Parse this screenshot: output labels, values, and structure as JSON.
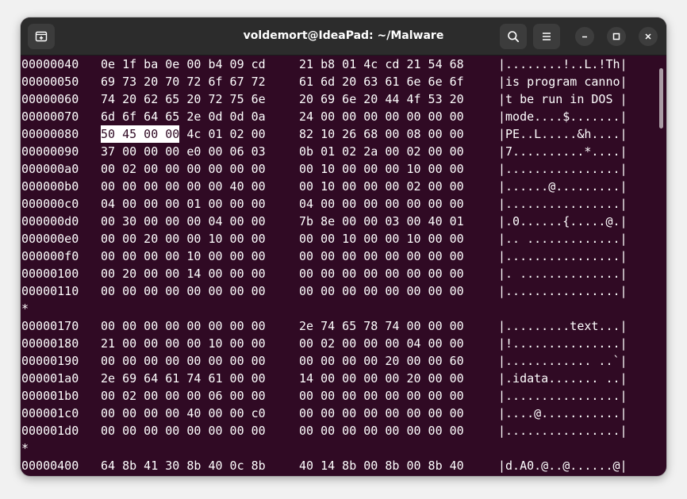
{
  "window": {
    "title": "voldemort@IdeaPad: ~/Malware"
  },
  "icons": {
    "new_tab": "new-tab-icon",
    "search": "search-icon",
    "menu": "hamburger-menu-icon",
    "minimize": "minimize-icon",
    "maximize": "maximize-icon",
    "close": "close-icon"
  },
  "colors": {
    "terminal_bg": "#300a24",
    "titlebar_bg": "#2c2c2c",
    "text": "#ffffff"
  },
  "hexdump": [
    {
      "addr": "00000040",
      "b1": "0e 1f ba 0e 00 b4 09 cd",
      "b2": "21 b8 01 4c cd 21 54 68",
      "ascii": "|........!..L.!Th|"
    },
    {
      "addr": "00000050",
      "b1": "69 73 20 70 72 6f 67 72",
      "b2": "61 6d 20 63 61 6e 6e 6f",
      "ascii": "|is program canno|"
    },
    {
      "addr": "00000060",
      "b1": "74 20 62 65 20 72 75 6e",
      "b2": "20 69 6e 20 44 4f 53 20",
      "ascii": "|t be run in DOS |"
    },
    {
      "addr": "00000070",
      "b1": "6d 6f 64 65 2e 0d 0d 0a",
      "b2": "24 00 00 00 00 00 00 00",
      "ascii": "|mode....$.......|"
    },
    {
      "addr": "00000080",
      "hl": "50 45 00 00",
      "b1rest": " 4c 01 02 00",
      "b2": "82 10 26 68 00 08 00 00",
      "ascii": "|PE..L.....&h....|"
    },
    {
      "addr": "00000090",
      "b1": "37 00 00 00 e0 00 06 03",
      "b2": "0b 01 02 2a 00 02 00 00",
      "ascii": "|7..........*....|"
    },
    {
      "addr": "000000a0",
      "b1": "00 02 00 00 00 00 00 00",
      "b2": "00 10 00 00 00 10 00 00",
      "ascii": "|................|"
    },
    {
      "addr": "000000b0",
      "b1": "00 00 00 00 00 00 40 00",
      "b2": "00 10 00 00 00 02 00 00",
      "ascii": "|......@.........|"
    },
    {
      "addr": "000000c0",
      "b1": "04 00 00 00 01 00 00 00",
      "b2": "04 00 00 00 00 00 00 00",
      "ascii": "|................|"
    },
    {
      "addr": "000000d0",
      "b1": "00 30 00 00 00 04 00 00",
      "b2": "7b 8e 00 00 03 00 40 01",
      "ascii": "|.0......{.....@.|"
    },
    {
      "addr": "000000e0",
      "b1": "00 00 20 00 00 10 00 00",
      "b2": "00 00 10 00 00 10 00 00",
      "ascii": "|.. .............|"
    },
    {
      "addr": "000000f0",
      "b1": "00 00 00 00 10 00 00 00",
      "b2": "00 00 00 00 00 00 00 00",
      "ascii": "|................|"
    },
    {
      "addr": "00000100",
      "b1": "00 20 00 00 14 00 00 00",
      "b2": "00 00 00 00 00 00 00 00",
      "ascii": "|. ..............|"
    },
    {
      "addr": "00000110",
      "b1": "00 00 00 00 00 00 00 00",
      "b2": "00 00 00 00 00 00 00 00",
      "ascii": "|................|"
    },
    {
      "star": "*"
    },
    {
      "addr": "00000170",
      "b1": "00 00 00 00 00 00 00 00",
      "b2": "2e 74 65 78 74 00 00 00",
      "ascii": "|.........text...|"
    },
    {
      "addr": "00000180",
      "b1": "21 00 00 00 00 10 00 00",
      "b2": "00 02 00 00 00 04 00 00",
      "ascii": "|!...............|"
    },
    {
      "addr": "00000190",
      "b1": "00 00 00 00 00 00 00 00",
      "b2": "00 00 00 00 20 00 00 60",
      "ascii": "|............ ..`|"
    },
    {
      "addr": "000001a0",
      "b1": "2e 69 64 61 74 61 00 00",
      "b2": "14 00 00 00 00 20 00 00",
      "ascii": "|.idata....... ..|"
    },
    {
      "addr": "000001b0",
      "b1": "00 02 00 00 00 06 00 00",
      "b2": "00 00 00 00 00 00 00 00",
      "ascii": "|................|"
    },
    {
      "addr": "000001c0",
      "b1": "00 00 00 00 40 00 00 c0",
      "b2": "00 00 00 00 00 00 00 00",
      "ascii": "|....@...........|"
    },
    {
      "addr": "000001d0",
      "b1": "00 00 00 00 00 00 00 00",
      "b2": "00 00 00 00 00 00 00 00",
      "ascii": "|................|"
    },
    {
      "star": "*"
    },
    {
      "addr": "00000400",
      "b1": "64 8b 41 30 8b 40 0c 8b",
      "b2": "40 14 8b 00 8b 00 8b 40",
      "ascii": "|d.A0.@..@......@|"
    }
  ]
}
